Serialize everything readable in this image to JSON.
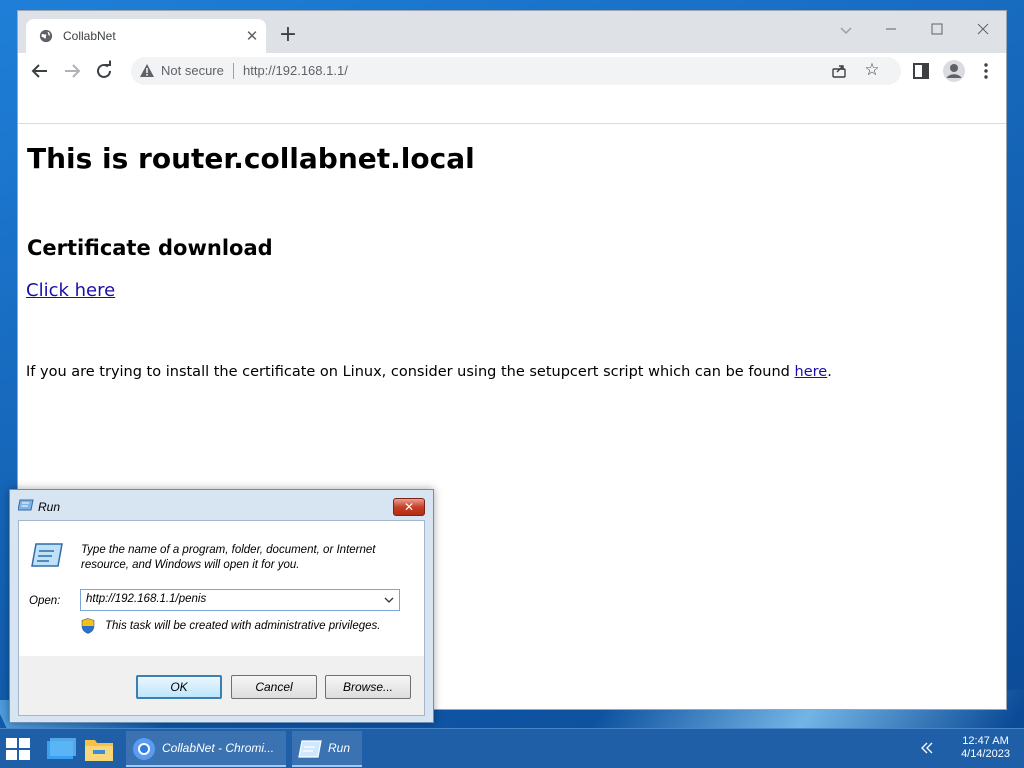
{
  "browser": {
    "tab_title": "CollabNet",
    "security_label": "Not secure",
    "url": "http://192.168.1.1/"
  },
  "page": {
    "heading": "This is router.collabnet.local",
    "subheading": "Certificate download",
    "link_text": "Click here",
    "paragraph_text": "If you are trying to install the certificate on Linux, consider using the setupcert script which can be found ",
    "paragraph_link": "here",
    "paragraph_end": "."
  },
  "run_dialog": {
    "title": "Run",
    "description": "Type the name of a program, folder, document, or Internet resource, and Windows will open it for you.",
    "open_label": "Open:",
    "open_value": "http://192.168.1.1/penis",
    "admin_note": "This task will be created with administrative privileges.",
    "ok_label": "OK",
    "cancel_label": "Cancel",
    "browse_label": "Browse..."
  },
  "taskbar": {
    "apps": [
      {
        "label": "CollabNet - Chromi..."
      },
      {
        "label": "Run"
      }
    ],
    "time": "12:47 AM",
    "date": "4/14/2023"
  },
  "colors": {
    "link": "#1a0dab",
    "taskbar": "#1f5fa8",
    "desktop": "#1565b8"
  }
}
